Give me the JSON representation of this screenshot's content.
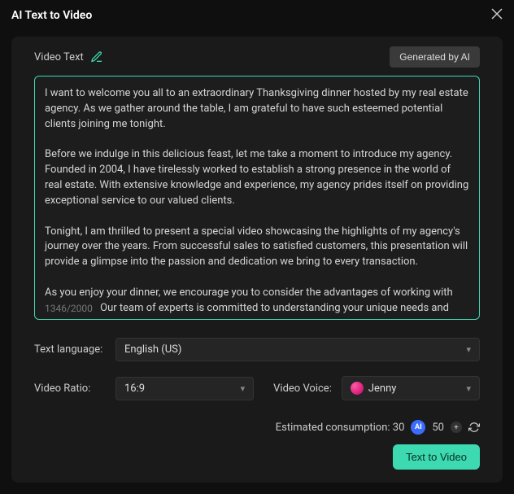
{
  "header": {
    "title": "AI Text to Video"
  },
  "editor": {
    "label": "Video Text",
    "gen_button": "Generated by AI",
    "text": "I want to welcome you all to an extraordinary Thanksgiving dinner hosted by my real estate agency. As we gather around the table, I am grateful to have such esteemed potential clients joining me tonight.\n\nBefore we indulge in this delicious feast, let me take a moment to introduce my agency. Founded in 2004, I have tirelessly worked to establish a strong presence in the world of real estate. With extensive knowledge and experience, my agency prides itself on providing exceptional service to our valued clients.\n\nTonight, I am thrilled to present a special video showcasing the highlights of my agency's journey over the years. From successful sales to satisfied customers, this presentation will provide a glimpse into the passion and dedication we bring to every transaction.\n\nAs you enjoy your dinner, we encourage you to consider the advantages of working with my agency. Our team of experts is committed to understanding your unique needs and finding the perfect property that aligns with your desires. With a proven track record of excellence, we ensure a stress-free and smooth real estate experience.\n\nThank you for joining us tonight and being a part of this special occasion. May this Thanksgiving",
    "counter": "1346/2000"
  },
  "form": {
    "language_label": "Text language:",
    "language_value": "English (US)",
    "ratio_label": "Video Ratio:",
    "ratio_value": "16:9",
    "voice_label": "Video Voice:",
    "voice_value": "Jenny"
  },
  "footer": {
    "consumption_label": "Estimated consumption: 30",
    "credits": "50",
    "submit": "Text to Video"
  }
}
